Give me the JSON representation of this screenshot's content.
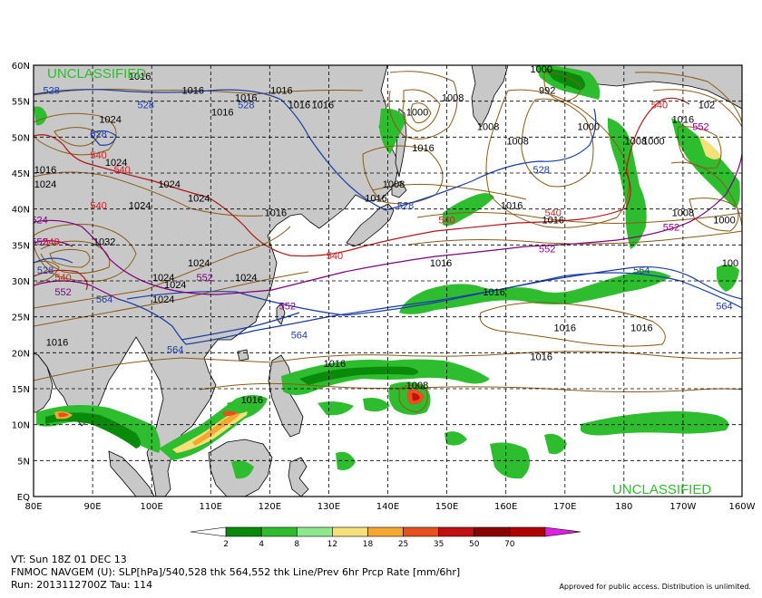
{
  "classification": "UNCLASSIFIED",
  "footer": {
    "valid_time": "VT: Sun 18Z 01 DEC 13",
    "product": "FNMOC NAVGEM (U): SLP[hPa]/540,528 thk 564,552 thk Line/Prev 6hr Prcp Rate [mm/6hr]",
    "run": "Run: 2013112700Z Tau: 114",
    "approval": "Approved for public access. Distribution is unlimited."
  },
  "axes": {
    "lat_labels": [
      "60N",
      "55N",
      "50N",
      "45N",
      "40N",
      "35N",
      "30N",
      "25N",
      "20N",
      "15N",
      "10N",
      "5N",
      "EQ"
    ],
    "lon_labels": [
      "80E",
      "90E",
      "100E",
      "110E",
      "120E",
      "130E",
      "140E",
      "150E",
      "160E",
      "170E",
      "180",
      "170W",
      "160W"
    ]
  },
  "colorbar": {
    "ticks": [
      "2",
      "4",
      "8",
      "12",
      "18",
      "25",
      "35",
      "50",
      "70"
    ],
    "colors": [
      "#ffffff",
      "#0a8a0a",
      "#2ebd2e",
      "#8ee88e",
      "#f5e07a",
      "#f5a830",
      "#e85020",
      "#c01010",
      "#8a0000",
      "#b00000",
      "#e020e0"
    ]
  },
  "contour_labels": {
    "slp": [
      {
        "text": "1016",
        "lon": 98,
        "lat": 58
      },
      {
        "text": "1016",
        "lon": 107,
        "lat": 56
      },
      {
        "text": "1016",
        "lon": 122,
        "lat": 56
      },
      {
        "text": "1016",
        "lon": 125,
        "lat": 54
      },
      {
        "text": "1016",
        "lon": 129,
        "lat": 54
      },
      {
        "text": "1016",
        "lon": 146,
        "lat": 48
      },
      {
        "text": "1000",
        "lon": 145,
        "lat": 53
      },
      {
        "text": "1008",
        "lon": 151,
        "lat": 55
      },
      {
        "text": "1008",
        "lon": 157,
        "lat": 51
      },
      {
        "text": "1008",
        "lon": 162,
        "lat": 49
      },
      {
        "text": "1000",
        "lon": 166,
        "lat": 59
      },
      {
        "text": "992",
        "lon": 167,
        "lat": 56
      },
      {
        "text": "1000",
        "lon": 174,
        "lat": 51
      },
      {
        "text": "1008",
        "lon": 182,
        "lat": 49
      },
      {
        "text": "1000",
        "lon": 185,
        "lat": 49
      },
      {
        "text": "1024",
        "lon": 93,
        "lat": 52
      },
      {
        "text": "1024",
        "lon": 94,
        "lat": 46
      },
      {
        "text": "1024",
        "lon": 103,
        "lat": 43
      },
      {
        "text": "1024",
        "lon": 82,
        "lat": 43
      },
      {
        "text": "1016",
        "lon": 82,
        "lat": 45
      },
      {
        "text": "1024",
        "lon": 104,
        "lat": 29
      },
      {
        "text": "1024",
        "lon": 102,
        "lat": 30
      },
      {
        "text": "1024",
        "lon": 108,
        "lat": 32
      },
      {
        "text": "1024",
        "lon": 108,
        "lat": 41
      },
      {
        "text": "1024",
        "lon": 98,
        "lat": 40
      },
      {
        "text": "1032",
        "lon": 92,
        "lat": 35
      },
      {
        "text": "1024",
        "lon": 102,
        "lat": 27
      },
      {
        "text": "1008",
        "lon": 141,
        "lat": 43
      },
      {
        "text": "1016",
        "lon": 138,
        "lat": 41
      },
      {
        "text": "1016",
        "lon": 121,
        "lat": 39
      },
      {
        "text": "1016",
        "lon": 116,
        "lat": 55
      },
      {
        "text": "1016",
        "lon": 112,
        "lat": 53
      },
      {
        "text": "1016",
        "lon": 161,
        "lat": 40
      },
      {
        "text": "1016",
        "lon": 168,
        "lat": 38
      },
      {
        "text": "1016",
        "lon": 149,
        "lat": 32
      },
      {
        "text": "1016",
        "lon": 158,
        "lat": 28
      },
      {
        "text": "1016",
        "lon": 170,
        "lat": 23
      },
      {
        "text": "1016",
        "lon": 183,
        "lat": 23
      },
      {
        "text": "1016",
        "lon": 166,
        "lat": 19
      },
      {
        "text": "1016",
        "lon": 131,
        "lat": 18
      },
      {
        "text": "1016",
        "lon": 84,
        "lat": 21
      },
      {
        "text": "1016",
        "lon": 117,
        "lat": 13
      },
      {
        "text": "1024",
        "lon": 116,
        "lat": 30
      },
      {
        "text": "1008",
        "lon": 145,
        "lat": 15
      },
      {
        "text": "1008",
        "lon": 190,
        "lat": 39
      },
      {
        "text": "1000",
        "lon": 197,
        "lat": 38
      },
      {
        "text": "100",
        "lon": 198,
        "lat": 32
      },
      {
        "text": "102",
        "lon": 194,
        "lat": 54
      },
      {
        "text": "1016",
        "lon": 190,
        "lat": 52
      }
    ],
    "thk528": [
      {
        "text": "528",
        "lon": 83,
        "lat": 56
      },
      {
        "text": "528",
        "lon": 99,
        "lat": 54
      },
      {
        "text": "528",
        "lon": 116,
        "lat": 54
      },
      {
        "text": "528",
        "lon": 91,
        "lat": 50
      },
      {
        "text": "528",
        "lon": 82,
        "lat": 31
      },
      {
        "text": "528",
        "lon": 143,
        "lat": 40
      },
      {
        "text": "528",
        "lon": 166,
        "lat": 45
      },
      {
        "text": "564",
        "lon": 92,
        "lat": 27
      },
      {
        "text": "564",
        "lon": 104,
        "lat": 20
      },
      {
        "text": "564",
        "lon": 125,
        "lat": 22
      },
      {
        "text": "564",
        "lon": 183,
        "lat": 31
      },
      {
        "text": "564",
        "lon": 197,
        "lat": 26
      }
    ],
    "thk540": [
      {
        "text": "540",
        "lon": 95,
        "lat": 45
      },
      {
        "text": "540",
        "lon": 91,
        "lat": 40
      },
      {
        "text": "540",
        "lon": 91,
        "lat": 47
      },
      {
        "text": "540",
        "lon": 83,
        "lat": 35
      },
      {
        "text": "540",
        "lon": 85,
        "lat": 30
      },
      {
        "text": "540",
        "lon": 131,
        "lat": 33
      },
      {
        "text": "540",
        "lon": 150,
        "lat": 38
      },
      {
        "text": "540",
        "lon": 168,
        "lat": 39
      },
      {
        "text": "540",
        "lon": 186,
        "lat": 54
      }
    ],
    "thk552": [
      {
        "text": "524",
        "lon": 81,
        "lat": 38
      },
      {
        "text": "552",
        "lon": 81,
        "lat": 35
      },
      {
        "text": "552",
        "lon": 85,
        "lat": 28
      },
      {
        "text": "552",
        "lon": 109,
        "lat": 30
      },
      {
        "text": "552",
        "lon": 123,
        "lat": 26
      },
      {
        "text": "552",
        "lon": 167,
        "lat": 34
      },
      {
        "text": "552",
        "lon": 188,
        "lat": 37
      },
      {
        "text": "552",
        "lon": 193,
        "lat": 51
      }
    ]
  }
}
